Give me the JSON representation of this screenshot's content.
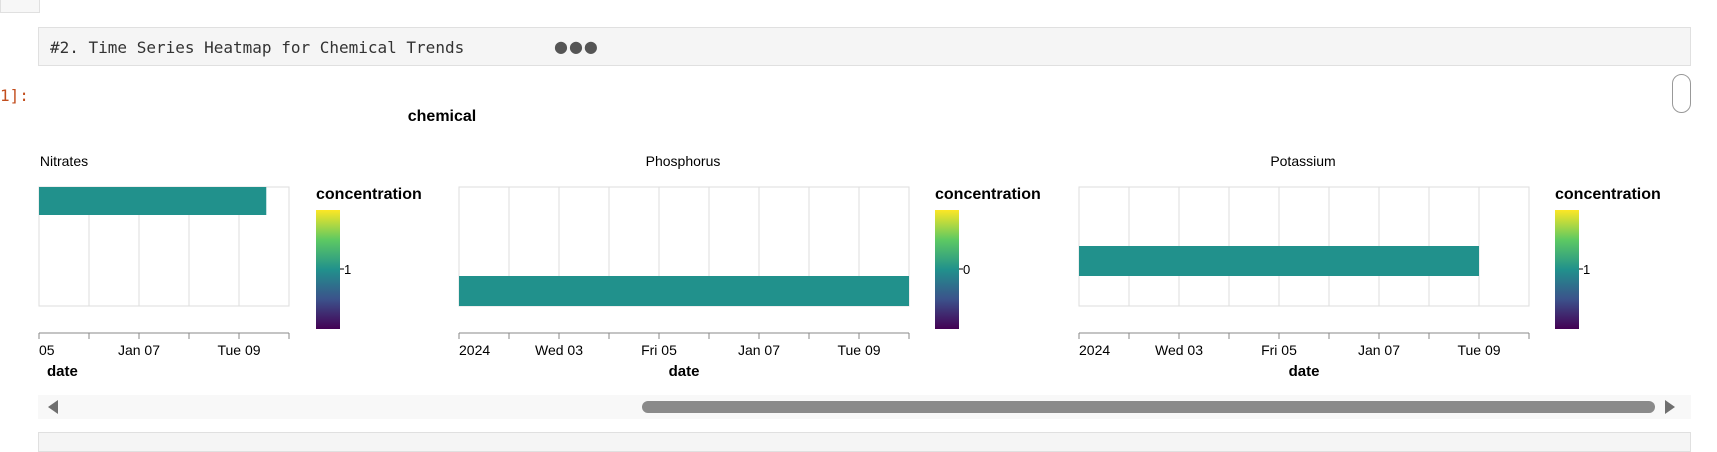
{
  "code_cell": {
    "text": "#2. Time Series Heatmap for Chemical Trends",
    "ellipsis": "●●●"
  },
  "prompt": "1]:",
  "next_cell": {
    "text": ""
  },
  "chart_data": {
    "type": "heatmap",
    "title": "chemical",
    "color_scale": "viridis",
    "bar_color": "#21918c",
    "panels": [
      {
        "name": "Nitrates",
        "xlabel": "date",
        "x_ticks": [
          "05",
          "Jan 07",
          "Tue 09"
        ],
        "legend_title": "concentration",
        "legend_tick": "1",
        "cells": [
          {
            "x_start": "2024-01-04",
            "x_end": "2024-01-09",
            "concentration": 1
          }
        ]
      },
      {
        "name": "Phosphorus",
        "xlabel": "date",
        "x_ticks": [
          "2024",
          "Wed 03",
          "Fri 05",
          "Jan 07",
          "Tue 09"
        ],
        "legend_title": "concentration",
        "legend_tick": "0",
        "cells": [
          {
            "x_start": "2024-01-01",
            "x_end": "2024-01-10",
            "concentration": 0
          }
        ]
      },
      {
        "name": "Potassium",
        "xlabel": "date",
        "x_ticks": [
          "2024",
          "Wed 03",
          "Fri 05",
          "Jan 07",
          "Tue 09"
        ],
        "legend_title": "concentration",
        "legend_tick": "1",
        "cells": [
          {
            "x_start": "2024-01-01",
            "x_end": "2024-01-09",
            "concentration": 1
          }
        ]
      }
    ]
  }
}
